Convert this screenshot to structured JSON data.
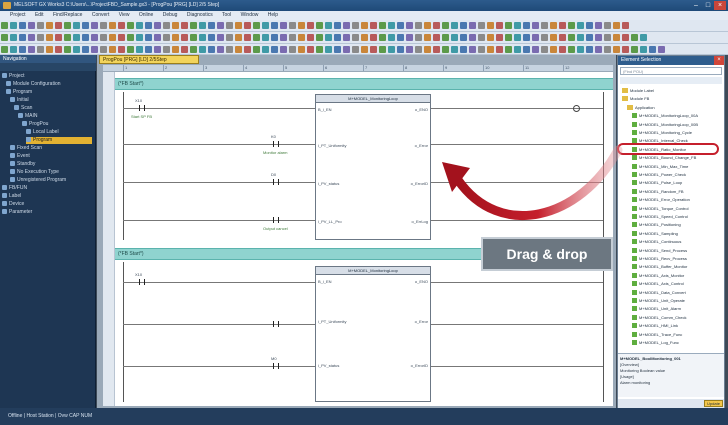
{
  "window": {
    "title": "MELSOFT GX Works3 C:\\Users\\...\\ProjectFBD_Sample.gx3 - [ProgPou [PRG] [LD] 2/5 Step]"
  },
  "menu": [
    "Project",
    "Edit",
    "Find/Replace",
    "Convert",
    "View",
    "Online",
    "Debug",
    "Diagnostics",
    "Tool",
    "Window",
    "Help"
  ],
  "navigation": {
    "title": "Navigation",
    "items": [
      "Project",
      "Module Configuration",
      "Program",
      "Initial",
      "Scan",
      "MAIN",
      "ProgPou",
      "Local Label",
      "Program",
      "Fixed Scan",
      "Event",
      "Standby",
      "No Execution Type",
      "Unregistered Program",
      "FB/FUN",
      "Label",
      "Device",
      "Parameter"
    ]
  },
  "editor": {
    "tab": "ProgPou [PRG] [LD] 2/5Step",
    "ruler": [
      "1",
      "2",
      "3",
      "4",
      "5",
      "6",
      "7",
      "8",
      "9",
      "10",
      "11",
      "12"
    ],
    "band1": "(*FB Start*)",
    "band2": "(*FB Start*)",
    "fb1": {
      "title": "M+MODEL_MonitoringLoop",
      "lbl_row1_l": "B_i_EN",
      "lbl_row1_r": "o_ENO",
      "lbl_row2_l": "i_PT_Uniformity",
      "lbl_row2_r": "o_Error",
      "lbl_row3_l": "i_PV_status",
      "lbl_row3_r": "o_ErrorID",
      "lbl_row4_l": "i_PV_LL_Pro",
      "lbl_row4_r": "o_ErrLog"
    },
    "fb2": {
      "title": "M+MODEL_MonitoringLoop",
      "lbl_row1_l": "B_i_EN",
      "lbl_row1_r": "o_ENO",
      "lbl_row2_l": "i_PT_Uniformity",
      "lbl_row2_r": "o_Error",
      "lbl_row3_l": "i_PV_status",
      "lbl_row3_r": "o_ErrorID"
    },
    "rung_labels": [
      "X10",
      "Start SP FB",
      "K0",
      "Monitor alarm",
      "D0",
      "Output cancel",
      "M0"
    ]
  },
  "element_panel": {
    "title": "Element Selection",
    "search_placeholder": "(Find POU)",
    "items": [
      "Module Label",
      "Module FB",
      "Application",
      "M+MODEL_MonitoringLoop_00A",
      "M+MODEL_MonitoringLoop_00B",
      "M+MODEL_Monitoring_Cycle",
      "M+MODEL_Interval_Check",
      "M+MODEL_Ratio_Monitor",
      "M+MODEL_Bound_Change_FB",
      "M+MODEL_Min_Max_Time",
      "M+MODEL_Power_Check",
      "M+MODEL_Pulse_Loop",
      "M+MODEL_Random_FB",
      "M+MODEL_Error_Operation",
      "M+MODEL_Torque_Control",
      "M+MODEL_Speed_Control",
      "M+MODEL_Positioning",
      "M+MODEL_Sampling",
      "M+MODEL_Continuous",
      "M+MODEL_Send_Process",
      "M+MODEL_Recv_Process",
      "M+MODEL_Buffer_Monitor",
      "M+MODEL_Axis_Monitor",
      "M+MODEL_Axis_Control",
      "M+MODEL_Data_Convert",
      "M+MODEL_Unit_Operate",
      "M+MODEL_Unit_Alarm",
      "M+MODEL_Comm_Check",
      "M+MODEL_HMI_Link",
      "M+MODEL_Trace_Func",
      "M+MODEL_Log_Func"
    ],
    "desc_title": "M+MODEL_BoolMonitoring_001",
    "desc_lines": [
      "[Overview]",
      "Monitoring Boolean value",
      "[Usage]",
      "Alarm monitoring"
    ],
    "footer_btn": "Update"
  },
  "callout": {
    "text": "Drag & drop"
  },
  "status": {
    "text": "Offline  |  Host Station  |  Ovw  CAP NUM"
  },
  "colors": {
    "accent_red": "#c51f2c",
    "band_teal": "#8fd3cf",
    "selected_yellow": "#e3b232"
  }
}
